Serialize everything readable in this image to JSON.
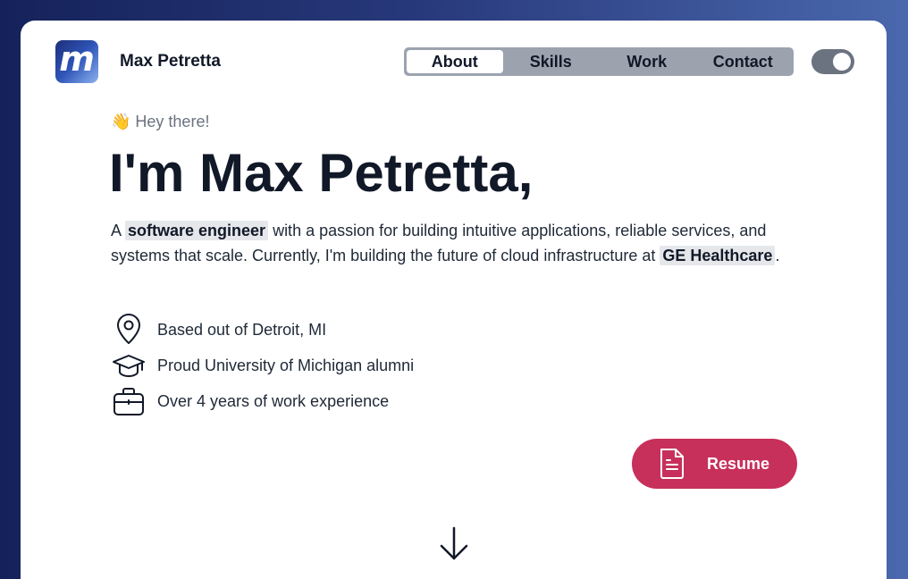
{
  "header": {
    "logo_letter": "m",
    "brand_name": "Max Petretta",
    "nav": [
      {
        "label": "About",
        "active": true
      },
      {
        "label": "Skills",
        "active": false
      },
      {
        "label": "Work",
        "active": false
      },
      {
        "label": "Contact",
        "active": false
      }
    ],
    "theme_toggle": {
      "on": true
    }
  },
  "hero": {
    "greeting": "👋 Hey there!",
    "headline": "I'm Max Petretta,",
    "intro": {
      "part1": "A ",
      "highlight1": "software engineer",
      "part2": " with a passion for building intuitive applications, reliable services, and systems that scale.  Currently, I'm building the future of cloud infrastructure at ",
      "highlight2": "GE Healthcare",
      "part3": "."
    },
    "facts": [
      {
        "icon": "location-pin-icon",
        "text": "Based out of Detroit, MI"
      },
      {
        "icon": "graduation-cap-icon",
        "text": "Proud University of Michigan alumni"
      },
      {
        "icon": "briefcase-icon",
        "text": "Over 4 years of work experience"
      }
    ],
    "resume_button": {
      "label": "Resume",
      "icon": "document-icon"
    }
  },
  "scroll_indicator": {
    "icon": "arrow-down-icon"
  },
  "colors": {
    "accent": "#c7305a",
    "text": "#111827",
    "muted": "#6b7280",
    "nav_bg": "#9ca3af",
    "highlight_bg": "#e5e7eb"
  }
}
